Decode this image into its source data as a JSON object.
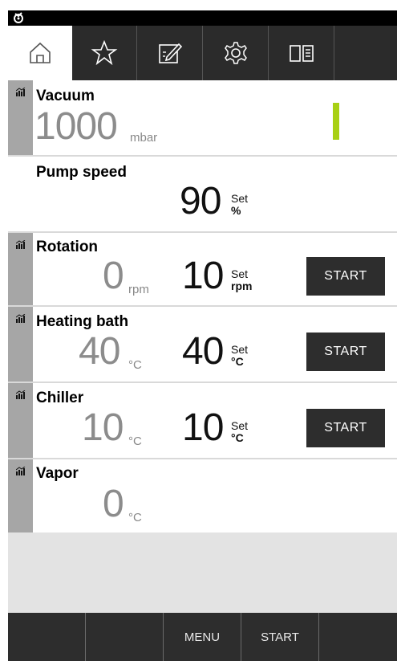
{
  "tabs": [
    {
      "icon": "home-icon",
      "active": true
    },
    {
      "icon": "star-icon",
      "active": false
    },
    {
      "icon": "notepad-icon",
      "active": false
    },
    {
      "icon": "gear-icon",
      "active": false
    },
    {
      "icon": "book-icon",
      "active": false
    },
    {
      "icon": "",
      "active": false
    }
  ],
  "vacuum": {
    "label": "Vacuum",
    "value": "1000",
    "unit": "mbar",
    "level_color": "#a8d014"
  },
  "pump": {
    "label": "Pump speed",
    "set_value": "90",
    "set_label": "Set",
    "set_unit": "%"
  },
  "rotation": {
    "label": "Rotation",
    "value": "0",
    "unit": "rpm",
    "set_value": "10",
    "set_label": "Set",
    "set_unit": "rpm",
    "button": "START"
  },
  "heating": {
    "label": "Heating bath",
    "value": "40",
    "unit": "°C",
    "set_value": "40",
    "set_label": "Set",
    "set_unit": "°C",
    "button": "START"
  },
  "chiller": {
    "label": "Chiller",
    "value": "10",
    "unit": "°C",
    "set_value": "10",
    "set_label": "Set",
    "set_unit": "°C",
    "button": "START"
  },
  "vapor": {
    "label": "Vapor",
    "value": "0",
    "unit": "°C"
  },
  "bottom": {
    "menu": "MENU",
    "start": "START"
  }
}
